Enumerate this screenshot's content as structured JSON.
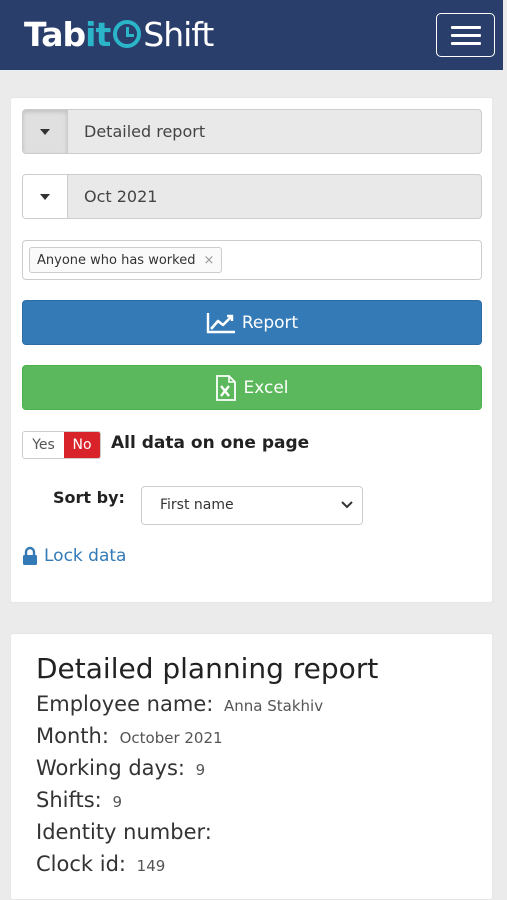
{
  "brand": {
    "tab": "Tab",
    "it": "it",
    "shift": "Shift"
  },
  "controls": {
    "report_type": "Detailed report",
    "month": "Oct 2021",
    "filter_tag": "Anyone who has worked",
    "filter_tag_remove": "×",
    "report_button": "Report",
    "excel_button": "Excel",
    "toggle_yes": "Yes",
    "toggle_no": "No",
    "toggle_selected": "No",
    "toggle_label": "All data on one page",
    "sort_label": "Sort by:",
    "sort_value": "First name",
    "lock_label": "Lock data"
  },
  "report": {
    "title": "Detailed planning report",
    "rows": [
      {
        "label": "Employee name:",
        "value": "Anna Stakhiv"
      },
      {
        "label": "Month:",
        "value": "October 2021"
      },
      {
        "label": "Working days:",
        "value": "9"
      },
      {
        "label": "Shifts:",
        "value": "9"
      },
      {
        "label": "Identity number:",
        "value": ""
      },
      {
        "label": "Clock id:",
        "value": "149"
      }
    ]
  },
  "colors": {
    "navbar": "#2a3e6c",
    "brand_accent": "#2bb5c9",
    "report_button": "#337ab7",
    "excel_button": "#5cb85c",
    "toggle_no": "#d9232b",
    "link": "#337ab7"
  },
  "icons": {
    "menu": "hamburger-icon",
    "report": "line-chart-icon",
    "excel": "excel-file-icon",
    "lock": "lock-icon",
    "dropdown": "caret-down-icon"
  }
}
